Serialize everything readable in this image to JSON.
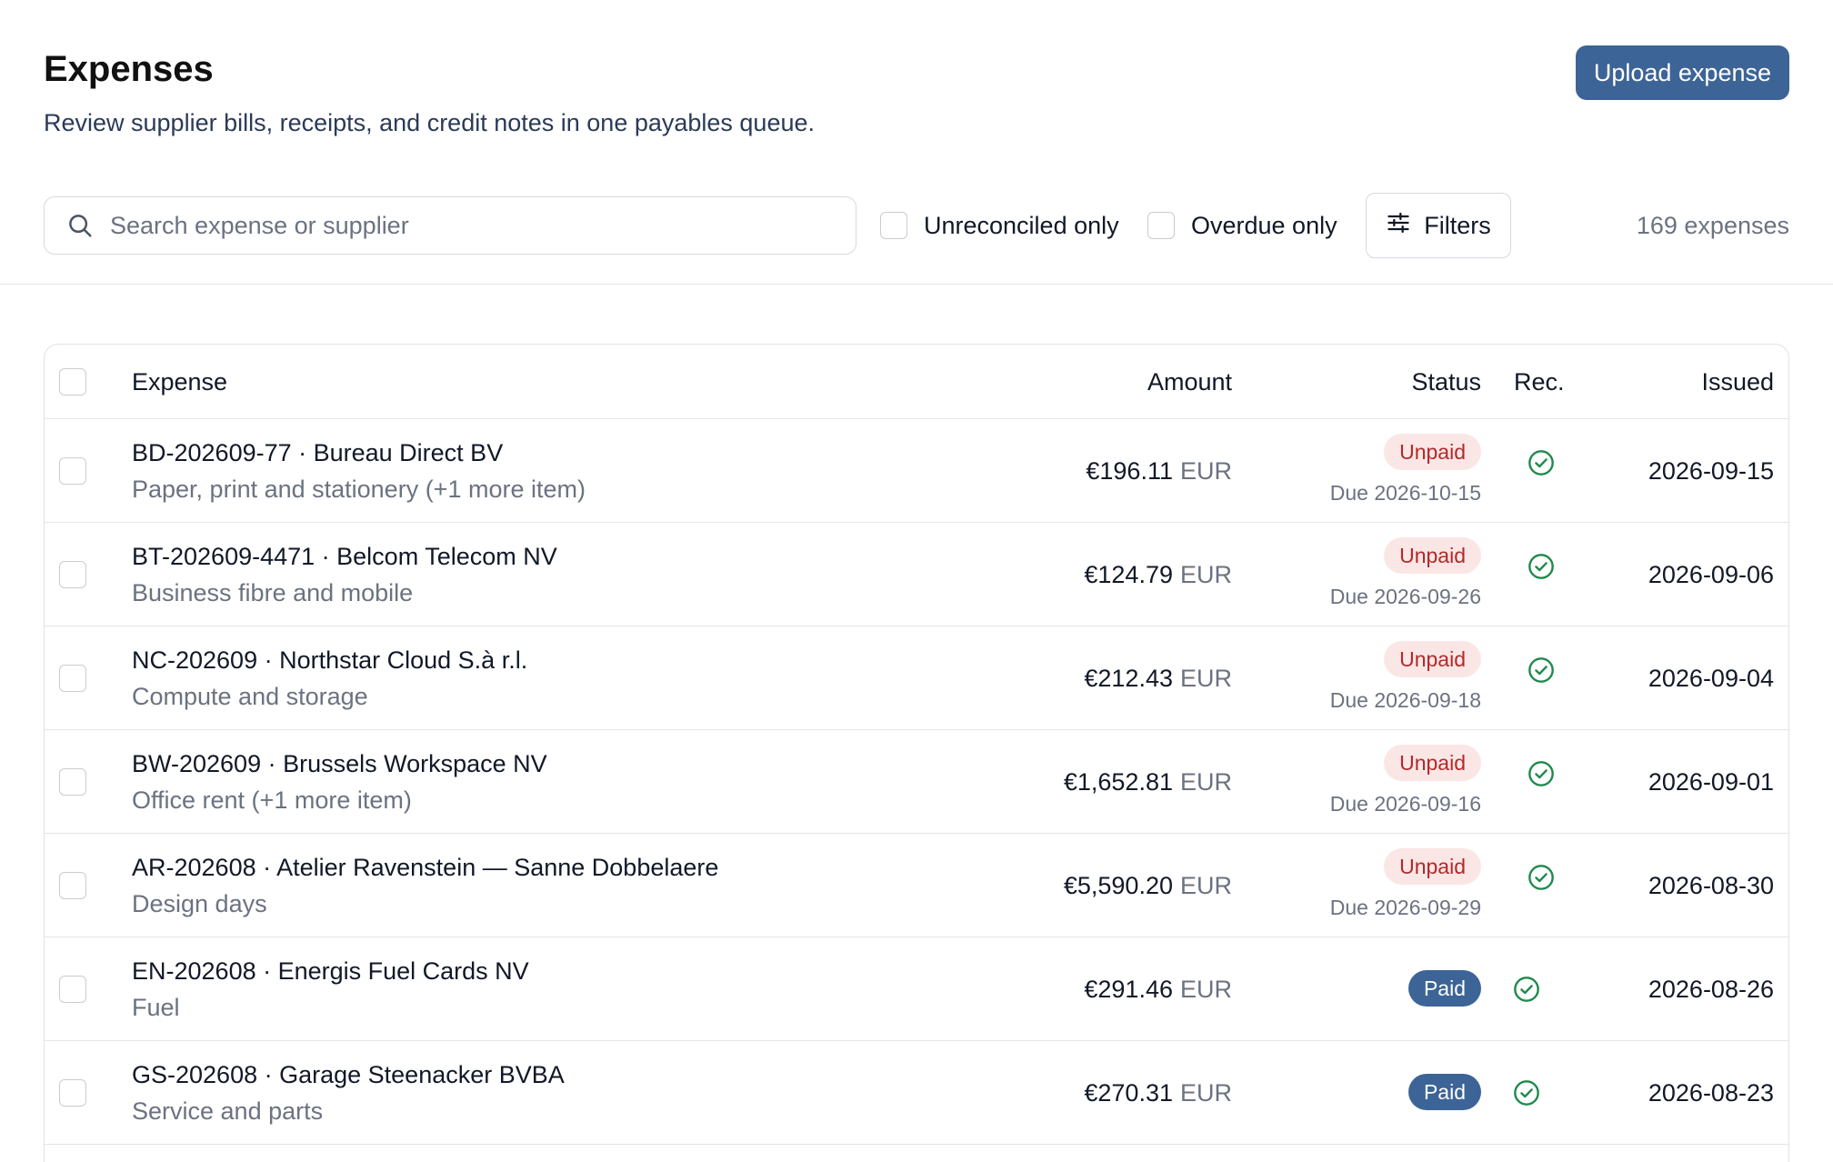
{
  "header": {
    "title": "Expenses",
    "subtitle": "Review supplier bills, receipts, and credit notes in one payables queue.",
    "upload_label": "Upload expense"
  },
  "toolbar": {
    "search_placeholder": "Search expense or supplier",
    "unreconciled_label": "Unreconciled only",
    "overdue_label": "Overdue only",
    "filters_label": "Filters",
    "count": "169 expenses"
  },
  "table": {
    "columns": {
      "expense": "Expense",
      "amount": "Amount",
      "status": "Status",
      "rec": "Rec.",
      "issued": "Issued"
    },
    "rows": [
      {
        "title": "BD-202609-77 · Bureau Direct BV",
        "subtitle": "Paper, print and stationery (+1 more item)",
        "amount": "€196.11",
        "currency": "EUR",
        "status": "Unpaid",
        "due": "Due 2026-10-15",
        "reconciled": true,
        "issued": "2026-09-15"
      },
      {
        "title": "BT-202609-4471 · Belcom Telecom NV",
        "subtitle": "Business fibre and mobile",
        "amount": "€124.79",
        "currency": "EUR",
        "status": "Unpaid",
        "due": "Due 2026-09-26",
        "reconciled": true,
        "issued": "2026-09-06"
      },
      {
        "title": "NC-202609 · Northstar Cloud S.à r.l.",
        "subtitle": "Compute and storage",
        "amount": "€212.43",
        "currency": "EUR",
        "status": "Unpaid",
        "due": "Due 2026-09-18",
        "reconciled": true,
        "issued": "2026-09-04"
      },
      {
        "title": "BW-202609 · Brussels Workspace NV",
        "subtitle": "Office rent (+1 more item)",
        "amount": "€1,652.81",
        "currency": "EUR",
        "status": "Unpaid",
        "due": "Due 2026-09-16",
        "reconciled": true,
        "issued": "2026-09-01"
      },
      {
        "title": "AR-202608 · Atelier Ravenstein — Sanne Dobbelaere",
        "subtitle": "Design days",
        "amount": "€5,590.20",
        "currency": "EUR",
        "status": "Unpaid",
        "due": "Due 2026-09-29",
        "reconciled": true,
        "issued": "2026-08-30"
      },
      {
        "title": "EN-202608 · Energis Fuel Cards NV",
        "subtitle": "Fuel",
        "amount": "€291.46",
        "currency": "EUR",
        "status": "Paid",
        "due": "",
        "reconciled": true,
        "issued": "2026-08-26"
      },
      {
        "title": "GS-202608 · Garage Steenacker BVBA",
        "subtitle": "Service and parts",
        "amount": "€270.31",
        "currency": "EUR",
        "status": "Paid",
        "due": "",
        "reconciled": true,
        "issued": "2026-08-23"
      }
    ]
  },
  "colors": {
    "primary": "#3d6496",
    "unpaid_bg": "#fbe6e6",
    "unpaid_text": "#b22a2a",
    "reconciled_icon": "#1f8a4c",
    "muted_text": "#6b7280"
  },
  "icons": {
    "search": "search-icon",
    "filters": "sliders-icon",
    "reconciled": "check-circle-icon"
  }
}
